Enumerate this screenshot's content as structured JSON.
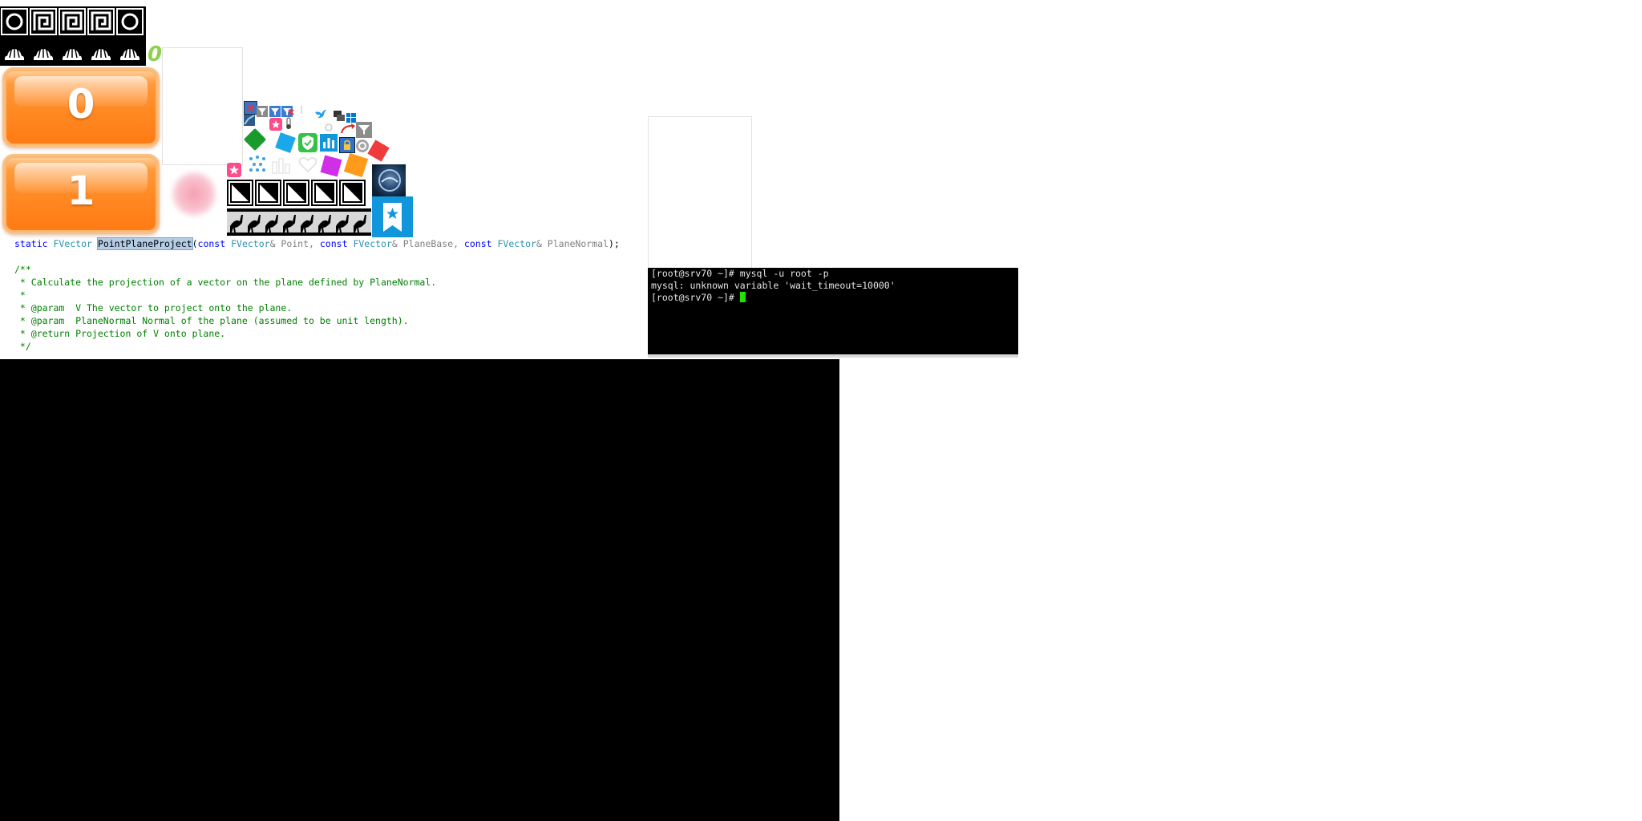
{
  "buttons": {
    "first_label": "0",
    "second_label": "1"
  },
  "green_digit": "0",
  "code": {
    "signature": {
      "kw_static": "static",
      "ret_type": "FVector",
      "func_name": "PointPlaneProject",
      "open": "(",
      "kw_const1": "const",
      "type1": "FVector",
      "p1": "& Point, ",
      "kw_const2": "const",
      "type2": "FVector",
      "p2": "& PlaneBase, ",
      "kw_const3": "const",
      "type3": "FVector",
      "p3": "& PlaneNormal",
      "close": ");"
    },
    "comment_lines": [
      "/**",
      " * Calculate the projection of a vector on the plane defined by PlaneNormal.",
      " *",
      " * @param  V The vector to project onto the plane.",
      " * @param  PlaneNormal Normal of the plane (assumed to be unit length).",
      " * @return Projection of V onto plane.",
      " */"
    ]
  },
  "terminal": {
    "lines": [
      "[root@srv70 ~]# mysql -u root -p",
      "mysql: unknown variable 'wait_timeout=10000'",
      "[root@srv70 ~]# "
    ]
  },
  "icons": [
    "greek-key-icon",
    "shell-icon",
    "star-bookmark-icon",
    "bar-chart-icon",
    "shield-check-icon",
    "filter-icon",
    "windows-logo-icon",
    "bird-icon",
    "heart-icon",
    "water-drops-icon",
    "thermometer-icon",
    "refresh-icon"
  ],
  "colors": {
    "orange_button": "#ff8a24",
    "terminal_bg": "#000000",
    "terminal_cursor": "#22e000",
    "code_keyword": "#0000ff",
    "code_type": "#2b91af",
    "code_comment": "#008000",
    "selection": "#b4cde6",
    "bookmark_blue": "#1296db"
  }
}
